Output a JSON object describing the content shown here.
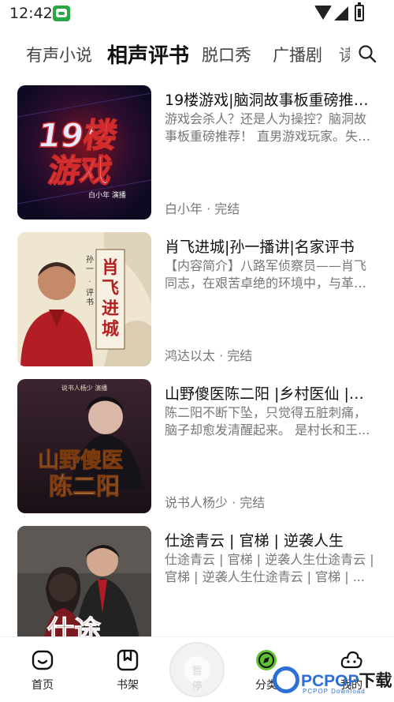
{
  "status_bar": {
    "time": "12:42",
    "icons": [
      "app-notification-icon",
      "wifi-icon",
      "signal-icon",
      "battery-icon"
    ]
  },
  "tabs": [
    {
      "label": "有声小说",
      "active": false
    },
    {
      "label": "相声评书",
      "active": true
    },
    {
      "label": "脱口秀",
      "active": false
    },
    {
      "label": "广播剧",
      "active": false
    },
    {
      "label": "读",
      "active": false
    }
  ],
  "search": {
    "icon": "search-icon"
  },
  "items": [
    {
      "title": "19楼游戏|脑洞故事板重磅推荐！",
      "desc": "游戏会杀人？还是人为操控？脑洞故事板重磅推荐！ 直男游戏玩家。失忆...",
      "meta": "白小年 · 完结",
      "cover": {
        "big_text_1": "19楼",
        "big_text_2": "游戏",
        "small_text": "白小年 演播",
        "bg": "#140c2a",
        "accent": "#d12a2a"
      }
    },
    {
      "title": "肖飞进城|孙一播讲|名家评书",
      "desc": "【内容简介】八路军侦察员——肖飞同志，在艰苦卓绝的环境中，与革命...",
      "meta": "鸿达以太 · 完结",
      "cover": {
        "big_text": "肖飞进城",
        "small_text_1": "孙一",
        "small_text_2": "评书",
        "bg": "#efe6d2",
        "accent": "#b22222"
      }
    },
    {
      "title": "山野傻医陈二阳 |乡村医仙 |【...",
      "desc": "陈二阳不断下坠，只觉得五脏刺痛，脑子却愈发清醒起来。 是村长和王...",
      "meta": "说书人杨少 · 完结",
      "cover": {
        "big_text_1": "山野傻医",
        "big_text_2": "陈二阳",
        "small_text": "说书人杨少 演播",
        "bg": "#2a1a22",
        "accent": "#d8a04a"
      }
    },
    {
      "title": "仕途青云 | 官梯 | 逆袭人生",
      "desc": "仕途青云 | 官梯 | 逆袭人生仕途青云 | 官梯 | 逆袭人生仕途青云 | 官梯 | ...",
      "meta": "",
      "cover": {
        "big_text": "仕途",
        "bg": "#3a3a3a",
        "accent": "#c8202a"
      }
    }
  ],
  "bottom_nav": [
    {
      "label": "首页",
      "icon": "home-icon"
    },
    {
      "label": "书架",
      "icon": "bookshelf-icon"
    },
    {
      "label": "分类",
      "icon": "discover-compass-icon"
    },
    {
      "label": "我的",
      "icon": "profile-cloud-icon"
    }
  ],
  "player": {
    "text": "暂停"
  },
  "watermark": {
    "main_latin": "PCPOP",
    "main_cn": "下载",
    "sub": "PCPOP Download"
  }
}
